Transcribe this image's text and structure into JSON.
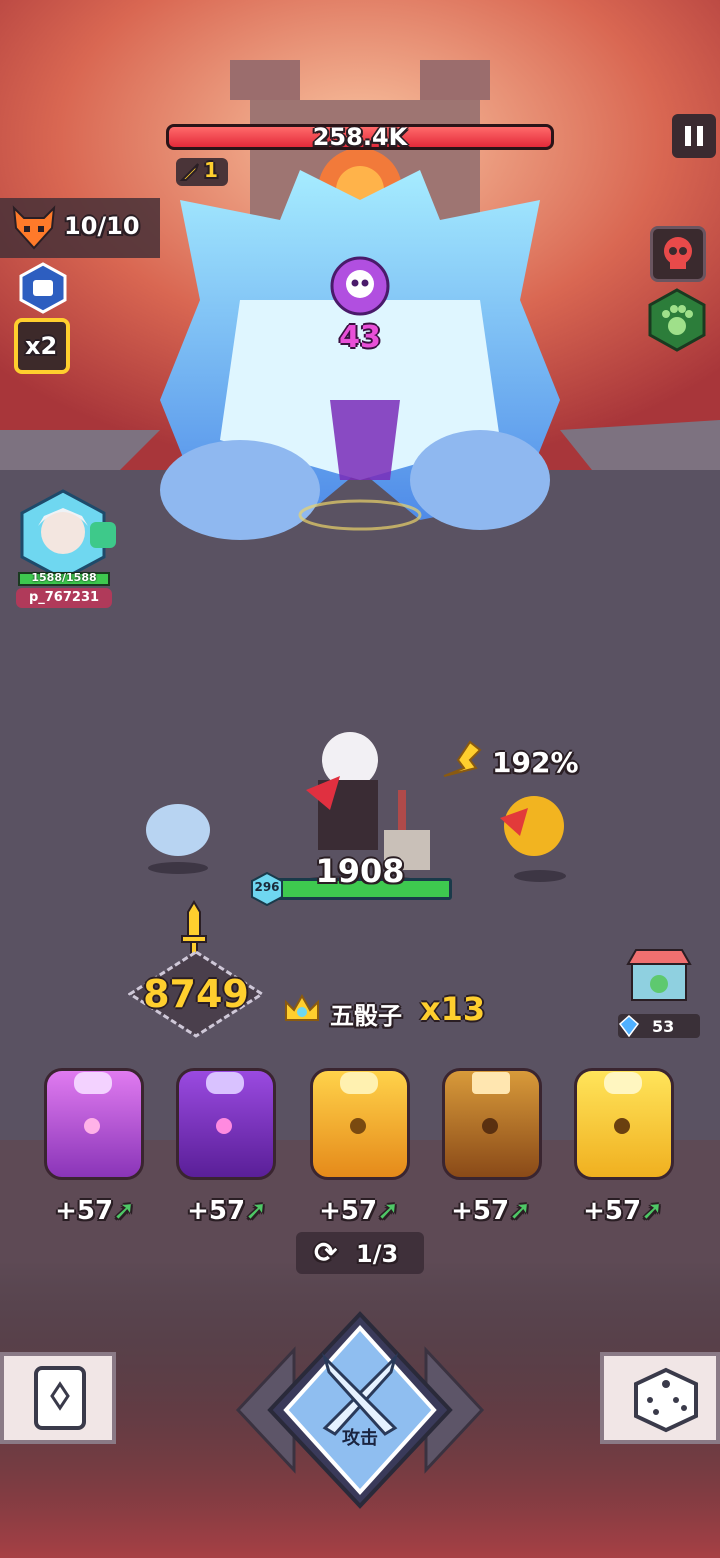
{
  "boss": {
    "hp_text": "258.4K",
    "hp_fraction": 1.0,
    "debuff_count": "1",
    "poison_stacks": "43"
  },
  "wave": {
    "counter": "10/10"
  },
  "speed": {
    "multiplier": "x2"
  },
  "ally": {
    "hp_text": "1588/1588",
    "name": "p_767231"
  },
  "hero": {
    "hp_text": "1908",
    "shield": "296",
    "crit_text": "192%"
  },
  "attack_power": {
    "value": "8749"
  },
  "combo": {
    "name": "五骰子",
    "multiplier": "x13"
  },
  "shop": {
    "gems": "53"
  },
  "dice_bonus": [
    "+57",
    "+57",
    "+57",
    "+57",
    "+57"
  ],
  "reroll": {
    "text": "1/3"
  },
  "attack_button": {
    "label": "攻击"
  },
  "colors": {
    "accent_gold": "#ffcf2e",
    "hp_red": "#e32a3a",
    "hp_green": "#3ec94f",
    "poison_purple": "#b14fe0"
  },
  "icons": [
    "pause-icon",
    "skull-icon",
    "paw-icon",
    "demon-icon",
    "sword-icon",
    "crown-icon",
    "gem-icon",
    "refresh-icon",
    "book-icon",
    "dice-icon",
    "crossed-swords-icon"
  ]
}
